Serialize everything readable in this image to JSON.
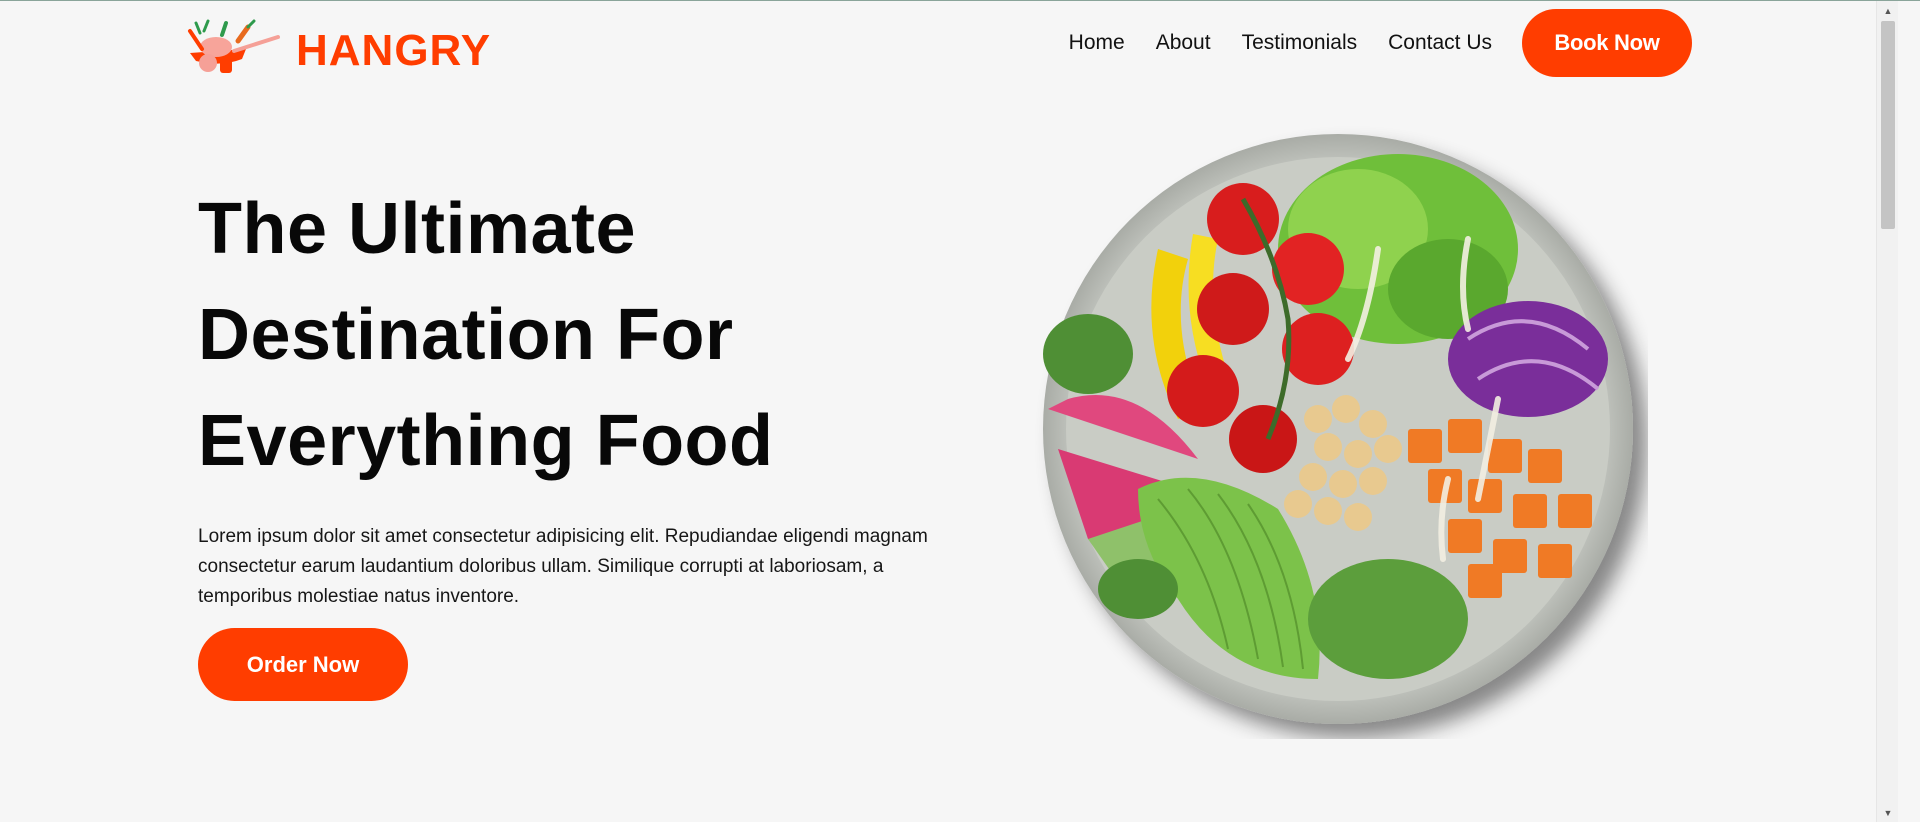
{
  "brand": {
    "name": "HANGRY",
    "logo_icon": "food-basket-logo",
    "color": "#ff3d00"
  },
  "nav": {
    "items": [
      {
        "label": "Home"
      },
      {
        "label": "About"
      },
      {
        "label": "Testimonials"
      },
      {
        "label": "Contact Us"
      }
    ],
    "cta_label": "Book Now"
  },
  "hero": {
    "title_lines": [
      "The Ultimate",
      "Destination For",
      "Everything Food"
    ],
    "description": "Lorem ipsum dolor sit amet consectetur adipisicing elit. Repudiandae eligendi magnam consectetur earum laudantium doloribus ullam. Similique corrupti at laboriosam, a temporibus molestiae natus inventore.",
    "cta_label": "Order Now",
    "image_icon": "salad-bowl-image"
  },
  "scrollbar": {
    "up_icon": "scroll-up-arrow-icon",
    "down_icon": "scroll-down-arrow-icon"
  }
}
